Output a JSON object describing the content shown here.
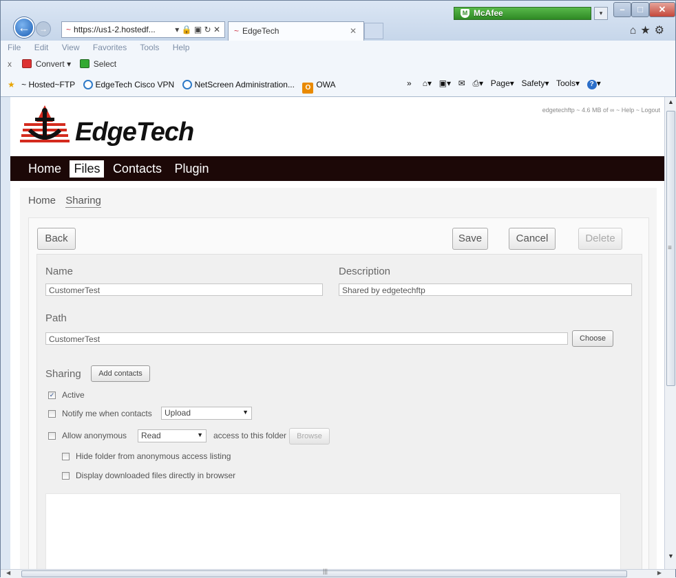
{
  "browser": {
    "address": "https://us1-2.hostedf...",
    "address_prefix": "~",
    "address_controls": "▾ 🔒 ▣ ↻ ✕",
    "tab_title": "EdgeTech",
    "tab_prefix": "~",
    "mcafee": "McAfee",
    "menu": [
      "File",
      "Edit",
      "View",
      "Favorites",
      "Tools",
      "Help"
    ],
    "convert_label": "Convert",
    "select_label": "Select",
    "favorites": [
      "~ Hosted~FTP",
      "EdgeTech Cisco VPN",
      "NetScreen Administration...",
      "OWA"
    ],
    "commands": [
      "Page",
      "Safety",
      "Tools"
    ]
  },
  "site": {
    "logo_text": "EdgeTech",
    "user_line": "edgetechftp ~ 4.6 MB of ∞ ~ Help ~ Logout",
    "nav": [
      {
        "label": "Home",
        "active": false
      },
      {
        "label": "Files",
        "active": true
      },
      {
        "label": "Contacts",
        "active": false
      },
      {
        "label": "Plugin",
        "active": false
      }
    ],
    "breadcrumb": {
      "home": "Home",
      "current": "Sharing"
    }
  },
  "toolbar": {
    "back": "Back",
    "save": "Save",
    "cancel": "Cancel",
    "delete": "Delete"
  },
  "form": {
    "name_label": "Name",
    "name_value": "CustomerTest",
    "description_label": "Description",
    "description_value": "Shared by edgetechftp",
    "path_label": "Path",
    "path_value": "CustomerTest",
    "choose": "Choose",
    "sharing_label": "Sharing",
    "add_contacts": "Add contacts",
    "active_label": "Active",
    "active_checked": true,
    "notify_label": "Notify me when contacts",
    "notify_value": "Upload",
    "anon_label": "Allow anonymous",
    "anon_value": "Read",
    "anon_suffix": "access to this folder",
    "browse": "Browse",
    "hide_label": "Hide folder from anonymous access listing",
    "display_label": "Display downloaded files directly in browser"
  },
  "colors": {
    "nav_bg": "#1c0807",
    "logo_red": "#d42b1e"
  }
}
